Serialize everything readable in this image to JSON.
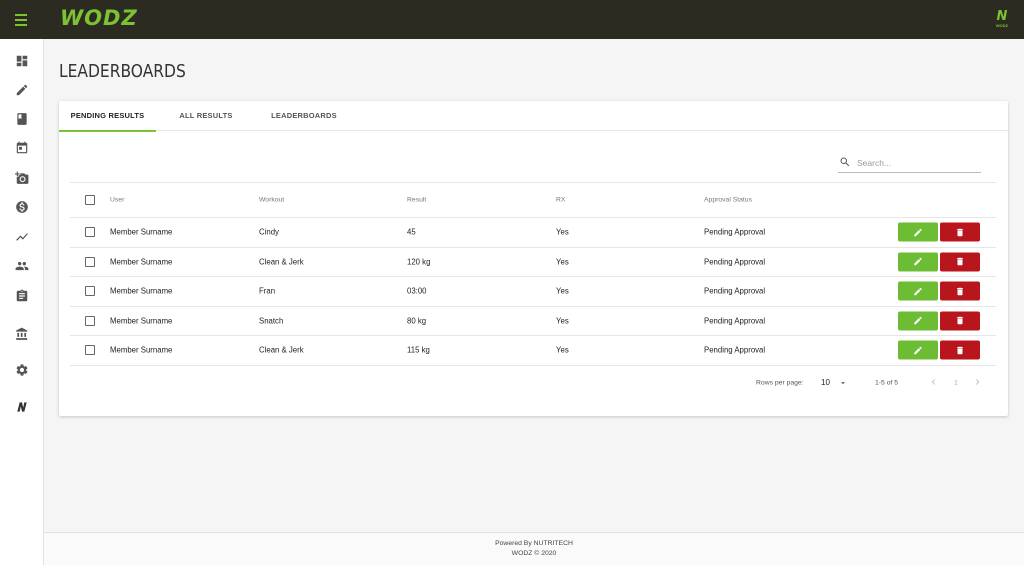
{
  "app": {
    "logo": "WODZ",
    "corner_logo": "N",
    "corner_logo_sub": "WODZ"
  },
  "sidebar": {
    "items": [
      {
        "name": "dashboard-icon"
      },
      {
        "name": "pencil-icon"
      },
      {
        "name": "book-icon"
      },
      {
        "name": "calendar-icon"
      },
      {
        "name": "add-photo-icon"
      },
      {
        "name": "dollar-icon"
      },
      {
        "name": "trending-icon"
      },
      {
        "name": "people-icon"
      },
      {
        "name": "clipboard-icon"
      },
      {
        "name": "bank-icon"
      },
      {
        "name": "settings-icon"
      },
      {
        "name": "n-logo-icon"
      }
    ]
  },
  "page": {
    "title": "LEADERBOARDS"
  },
  "tabs": [
    {
      "label": "PENDING RESULTS",
      "active": true
    },
    {
      "label": "ALL RESULTS",
      "active": false
    },
    {
      "label": "LEADERBOARDS",
      "active": false
    }
  ],
  "search": {
    "placeholder": "Search..."
  },
  "table": {
    "columns": [
      "User",
      "Workout",
      "Result",
      "RX",
      "Approval Status"
    ],
    "rows": [
      {
        "user": "Member Surname",
        "workout": "Cindy",
        "result": "45",
        "rx": "Yes",
        "status": "Pending Approval"
      },
      {
        "user": "Member Surname",
        "workout": "Clean & Jerk",
        "result": "120 kg",
        "rx": "Yes",
        "status": "Pending Approval"
      },
      {
        "user": "Member Surname",
        "workout": "Fran",
        "result": "03:00",
        "rx": "Yes",
        "status": "Pending Approval"
      },
      {
        "user": "Member Surname",
        "workout": "Snatch",
        "result": "80 kg",
        "rx": "Yes",
        "status": "Pending Approval"
      },
      {
        "user": "Member Surname",
        "workout": "Clean & Jerk",
        "result": "115 kg",
        "rx": "Yes",
        "status": "Pending Approval"
      }
    ]
  },
  "pagination": {
    "rows_per_page_label": "Rows per page:",
    "rows_per_page": "10",
    "range": "1-5 of 5",
    "page": "1"
  },
  "footer": {
    "line1": "Powered By NUTRITECH",
    "line2": "WODZ © 2020"
  },
  "colors": {
    "accent": "#7cc233",
    "topbar": "#2b2b22",
    "edit": "#6cbd34",
    "delete": "#b8161c"
  }
}
